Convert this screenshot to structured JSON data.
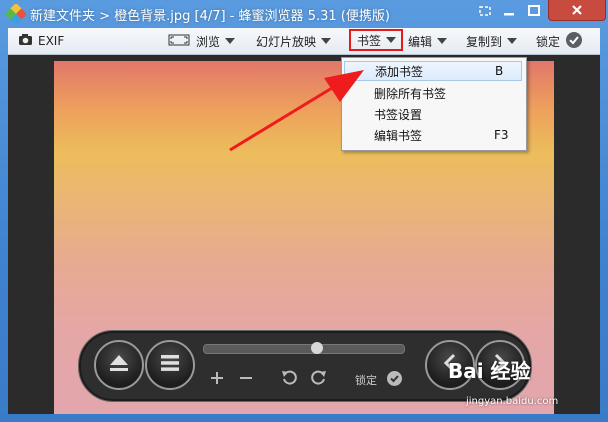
{
  "window": {
    "title": "新建文件夹 > 橙色背景.jpg [4/7] - 蜂蜜浏览器 5.31 (便携版)",
    "colors": {
      "title_bg": "#3f82cf",
      "close_bg": "#c74b3f"
    }
  },
  "toolbar": {
    "exif_label": "EXIF",
    "browse_label": "浏览",
    "slideshow_label": "幻灯片放映",
    "bookmark_label": "书签",
    "edit_label": "编辑",
    "copy_to_label": "复制到",
    "lock_label": "锁定",
    "highlight_color": "#e61a1a"
  },
  "bookmark_menu": {
    "items": [
      {
        "label": "添加书签",
        "shortcut": "B",
        "highlighted": true
      },
      {
        "label": "删除所有书签",
        "shortcut": "",
        "highlighted": false
      },
      {
        "label": "书签设置",
        "shortcut": "",
        "highlighted": false
      },
      {
        "label": "编辑书签",
        "shortcut": "F3",
        "highlighted": false
      }
    ]
  },
  "controls": {
    "lock_label": "锁定",
    "slider_fraction": 0.57
  },
  "watermark": {
    "main": "Bai 经验",
    "sub": "jingyan.baidu.com"
  }
}
